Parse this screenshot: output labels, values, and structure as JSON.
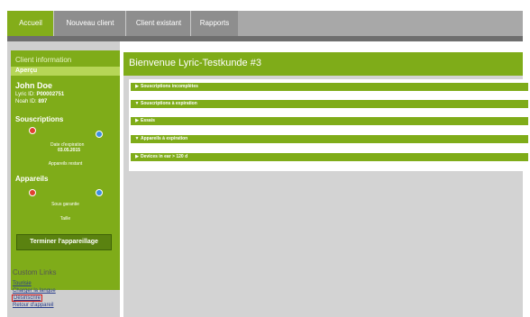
{
  "tabs": [
    {
      "label": "Accueil"
    },
    {
      "label": "Nouveau client"
    },
    {
      "label": "Client existant"
    },
    {
      "label": "Rapports"
    }
  ],
  "sidebar": {
    "title": "Client information",
    "overview_label": "Aperçu",
    "client_name": "John Doe",
    "lyric_id_label": "Lyric ID",
    "lyric_id": "P00002751",
    "noah_id_label": "Noah ID",
    "noah_id": "897",
    "subscriptions_title": "Souscriptions",
    "expiry_date_label": "Date d'expiration",
    "expiry_date": "03.05.2015",
    "remaining_devices_label": "Appareils restant",
    "devices_title": "Appareils",
    "warranty_label": "Sous garantie",
    "size_label": "Taille",
    "end_fitting_button": "Terminer l'appareillage"
  },
  "custom_links": {
    "title": "Custom Links",
    "links": [
      "Tourisie",
      "Charger la langue",
      "Désinscrire",
      "Retour d'appareil"
    ]
  },
  "main": {
    "title": "Bienvenue Lyric-Testkunde #3",
    "bars": [
      {
        "label": "Souscriptions incomplètes",
        "arrow": "▶"
      },
      {
        "label": "Souscriptions à expiration",
        "arrow": "▼"
      },
      {
        "label": "Essais",
        "arrow": "▶"
      },
      {
        "label": "Appareils à expiration",
        "arrow": "▼"
      },
      {
        "label": "Devices in ear > 120 d",
        "arrow": "▶"
      }
    ]
  },
  "colors": {
    "accent_green": "#7fac19",
    "dark_green": "#5a8210",
    "tab_grey": "#8e8e8e",
    "indicator_red": "#e0412f",
    "indicator_blue": "#3d8fe0"
  }
}
